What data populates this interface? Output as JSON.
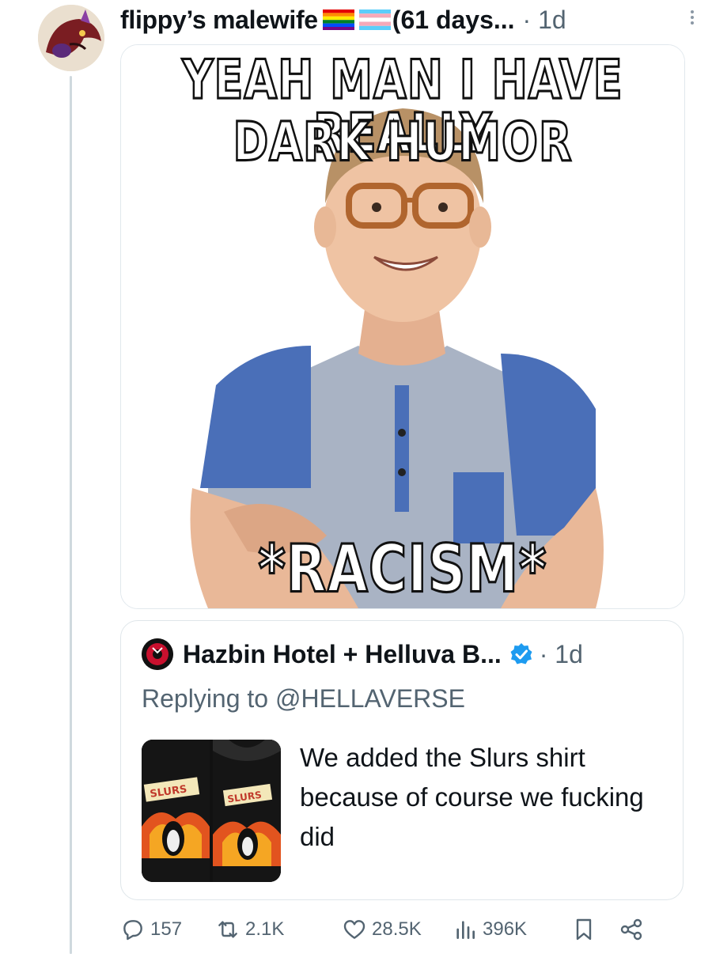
{
  "post": {
    "display_name": "flippy’s malewife",
    "name_suffix": "(61 days...",
    "time": "· 1d",
    "image_text": {
      "top_line1": "YEAH MAN I HAVE REALLY",
      "top_line2": "DARK HUMOR",
      "bottom": "*RACISM*"
    }
  },
  "quoted": {
    "name": "Hazbin Hotel + Helluva B...",
    "time": "· 1d",
    "replying_label": "Replying to",
    "replying_handle": "@HELLAVERSE",
    "text": "We added the Slurs shirt because of course we fucking did",
    "shirt_label": "SLURS"
  },
  "actions": {
    "replies": "157",
    "reposts": "2.1K",
    "likes": "28.5K",
    "views": "396K"
  },
  "colors": {
    "text": "#0f1419",
    "muted": "#536471",
    "border": "#cfd9de",
    "verified": "#1d9bf0"
  }
}
